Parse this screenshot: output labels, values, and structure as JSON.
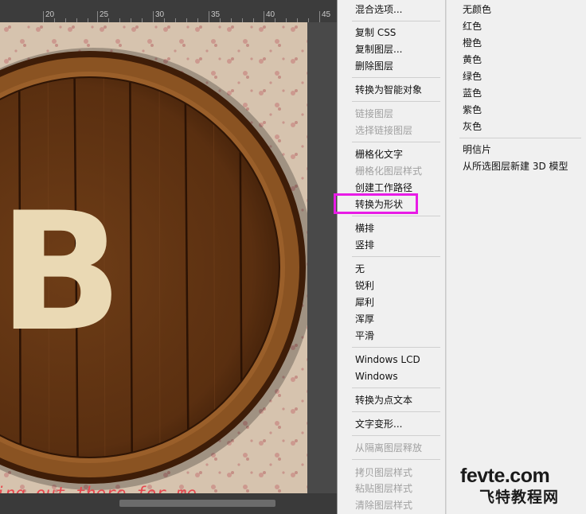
{
  "ruler": {
    "labels": [
      "20",
      "25",
      "30",
      "35",
      "40",
      "45"
    ]
  },
  "canvas": {
    "letter": "B",
    "caption": "ing out there for me",
    "colors": {
      "wood": "#6b3a14",
      "wood_dark": "#3a1c08",
      "letter": "#ead9b4",
      "paper": "#d8c6b2",
      "caption": "#e8474f"
    }
  },
  "context_menu": {
    "items": [
      {
        "label": "混合选项...",
        "enabled": true
      },
      {
        "label": "复制 CSS",
        "enabled": true
      },
      {
        "label": "复制图层...",
        "enabled": true
      },
      {
        "label": "删除图层",
        "enabled": true
      },
      {
        "label": "转换为智能对象",
        "enabled": true
      },
      {
        "label": "链接图层",
        "enabled": false
      },
      {
        "label": "选择链接图层",
        "enabled": false
      },
      {
        "label": "栅格化文字",
        "enabled": true
      },
      {
        "label": "栅格化图层样式",
        "enabled": false
      },
      {
        "label": "创建工作路径",
        "enabled": true
      },
      {
        "label": "转换为形状",
        "enabled": true,
        "highlighted": true
      },
      {
        "label": "横排",
        "enabled": true
      },
      {
        "label": "竖排",
        "enabled": true
      },
      {
        "label": "无",
        "enabled": true
      },
      {
        "label": "锐利",
        "enabled": true
      },
      {
        "label": "犀利",
        "enabled": true
      },
      {
        "label": "浑厚",
        "enabled": true
      },
      {
        "label": "平滑",
        "enabled": true
      },
      {
        "label": "Windows LCD",
        "enabled": true
      },
      {
        "label": "Windows",
        "enabled": true
      },
      {
        "label": "转换为点文本",
        "enabled": true
      },
      {
        "label": "文字变形...",
        "enabled": true
      },
      {
        "label": "从隔离图层释放",
        "enabled": false
      },
      {
        "label": "拷贝图层样式",
        "enabled": false
      },
      {
        "label": "粘贴图层样式",
        "enabled": false
      },
      {
        "label": "清除图层样式",
        "enabled": false
      }
    ],
    "highlight_color": "#e81be6"
  },
  "submenu": {
    "items": [
      {
        "label": "无颜色"
      },
      {
        "label": "红色"
      },
      {
        "label": "橙色"
      },
      {
        "label": "黄色"
      },
      {
        "label": "绿色"
      },
      {
        "label": "蓝色"
      },
      {
        "label": "紫色"
      },
      {
        "label": "灰色"
      },
      {
        "label": "明信片"
      },
      {
        "label": "从所选图层新建 3D 模型"
      }
    ]
  },
  "watermark": {
    "top": "fevte.com",
    "bottom": "飞特教程网"
  }
}
